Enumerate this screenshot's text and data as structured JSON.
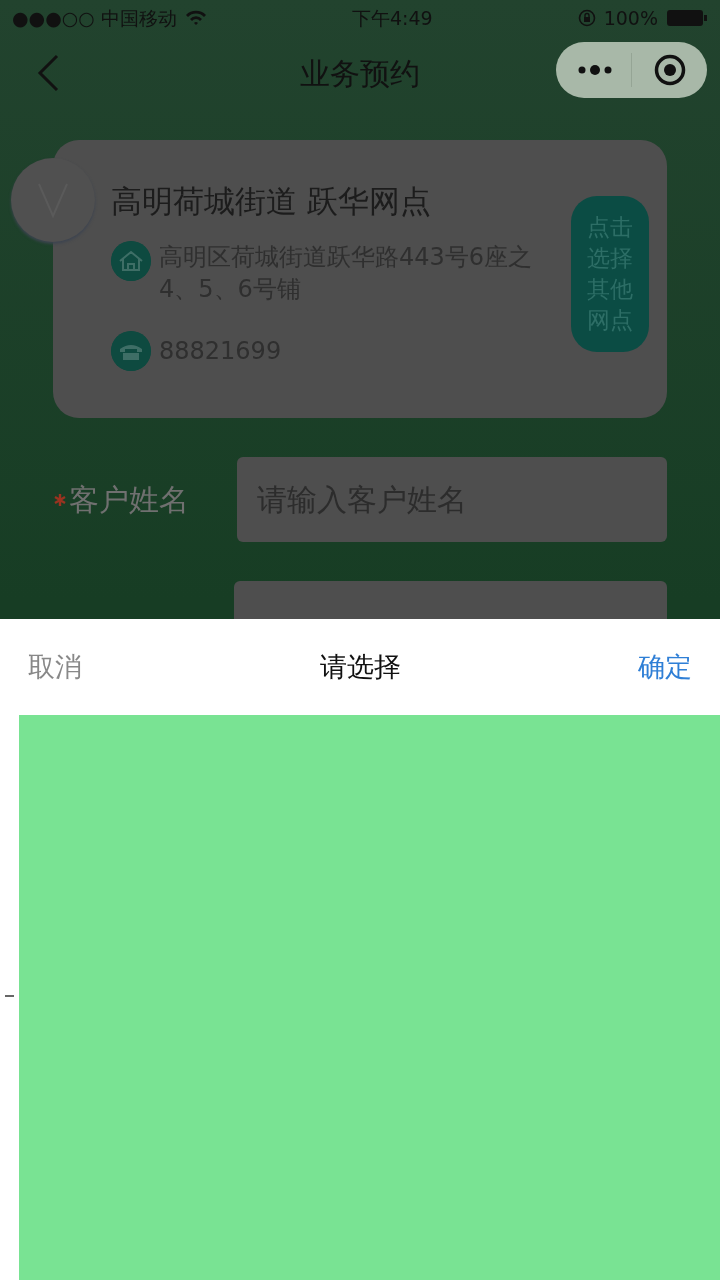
{
  "status_bar": {
    "carrier": "●●●○○ 中国移动",
    "time": "下午4:49",
    "battery": "100%"
  },
  "nav": {
    "title": "业务预约"
  },
  "branch": {
    "name": "高明荷城街道 跃华网点",
    "address": "高明区荷城街道跃华路443号6座之4、5、6号铺",
    "phone": "88821699",
    "change_button": "点击选择其他网点"
  },
  "form": [
    {
      "label": "客户姓名",
      "required": true,
      "placeholder": "请输入客户姓名"
    }
  ],
  "picker": {
    "cancel": "取消",
    "title": "请选择",
    "confirm": "确定"
  }
}
